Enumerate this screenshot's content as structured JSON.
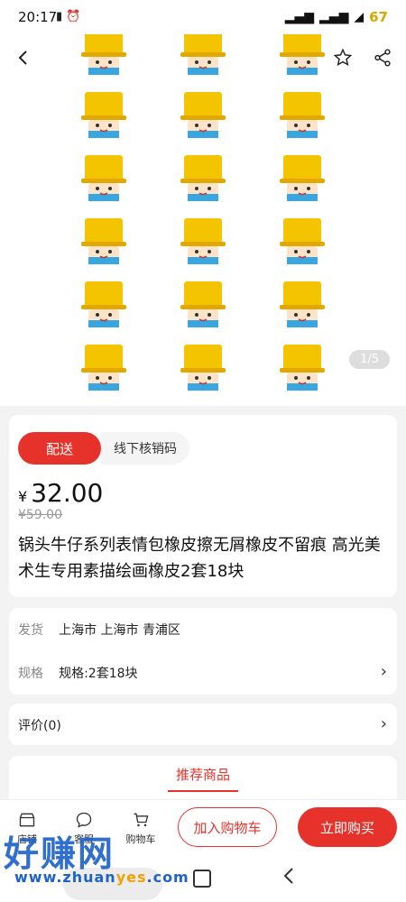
{
  "status": {
    "time": "20:17",
    "battery": "67"
  },
  "product": {
    "pager": "1/5",
    "tabs": [
      "配送",
      "线下核销码"
    ],
    "currency": "¥",
    "price": "32.00",
    "old_price": "¥59.00",
    "title": "锅头牛仔系列表情包橡皮擦无屑橡皮不留痕 高光美术生专用素描绘画橡皮2套18块"
  },
  "info": {
    "ship_label": "发货",
    "ship_value": "上海市 上海市 青浦区",
    "spec_label": "规格",
    "spec_value": "规格:2套18块",
    "review_label": "评价(0)",
    "recommend_title": "推荐商品"
  },
  "bottom": {
    "icon_labels": [
      "店铺",
      "客服",
      "购物车"
    ],
    "add_cart": "加入购物车",
    "buy_now": "立即购买"
  },
  "watermark": {
    "text": "好赚网",
    "url_left": "www.zhuan",
    "url_mid": "yes",
    "url_right": ".com"
  },
  "colors": {
    "accent": "#e6322b",
    "hat": "#f5c400"
  }
}
